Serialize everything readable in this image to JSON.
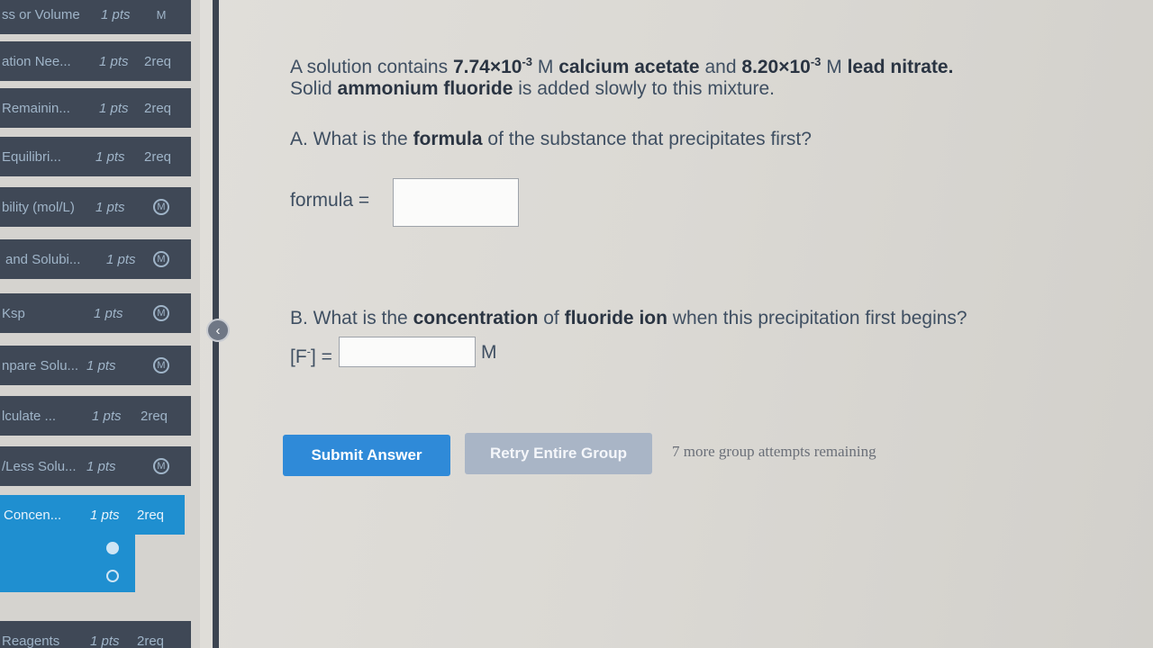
{
  "sidebar": {
    "items": [
      {
        "label": "ss or Volume",
        "pts": "1 pts",
        "badge": "M"
      },
      {
        "label": "ation Nee...",
        "pts": "1 pts",
        "req": "2req"
      },
      {
        "label": "Remainin...",
        "pts": "1 pts",
        "req": "2req"
      },
      {
        "label": "Equilibri...",
        "pts": "1 pts",
        "req": "2req"
      },
      {
        "label": "bility (mol/L)",
        "pts": "1 pts",
        "badge": "M"
      },
      {
        "label": "and Solubi...",
        "pts": "1 pts",
        "badge": "M"
      },
      {
        "label": "Ksp",
        "pts": "1 pts",
        "badge": "M"
      },
      {
        "label": "npare Solu...",
        "pts": "1 pts",
        "badge": "M"
      },
      {
        "label": "lculate ...",
        "pts": "1 pts",
        "req": "2req"
      },
      {
        "label": "/Less Solu...",
        "pts": "1 pts",
        "badge": "M"
      },
      {
        "label": "Concen...",
        "pts": "1 pts",
        "req": "2req"
      },
      {
        "label": "Reagents",
        "pts": "1 pts",
        "req": "2req"
      }
    ],
    "collapse_icon": "chevron-left-icon"
  },
  "problem": {
    "p1": "A solution contains ",
    "c1": "7.74×10",
    "c1_exp": "-3",
    "c1_unit": " M ",
    "salt1": "calcium acetate",
    "and": " and ",
    "c2": "8.20×10",
    "c2_exp": "-3",
    "c2_unit": " M ",
    "salt2": "lead nitrate.",
    "l2a": "Solid ",
    "l2b": "ammonium fluoride",
    "l2c": " is added slowly to this mixture."
  },
  "question_a": {
    "prefix": "A. What is the ",
    "bold": "formula",
    "suffix": " of the substance that precipitates first?",
    "label": "formula = ",
    "value": ""
  },
  "question_b": {
    "prefix": "B. What is the ",
    "bold1": "concentration",
    "mid": " of ",
    "bold2": "fluoride ion",
    "suffix": " when this precipitation first begins?",
    "label": "[F",
    "label_sup": "-",
    "label_end": "] = ",
    "value": "",
    "unit": "M"
  },
  "actions": {
    "submit": "Submit Answer",
    "retry": "Retry Entire Group",
    "remaining": "7 more group attempts remaining"
  },
  "colors": {
    "active": "#1f8fd0",
    "sidebar_item": "#3f4856",
    "submit": "#2f8ad8",
    "retry": "#a9b5c6"
  }
}
